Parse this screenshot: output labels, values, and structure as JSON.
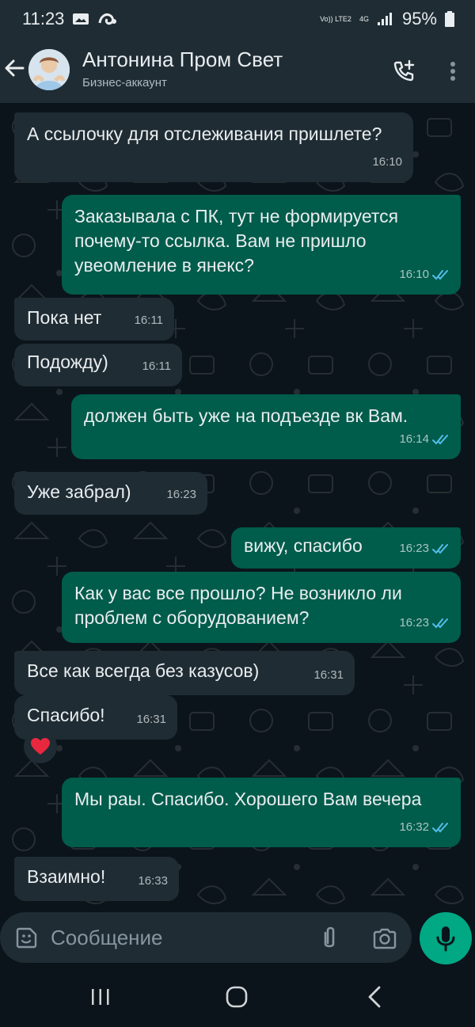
{
  "status_bar": {
    "time": "11:23",
    "network_label": "Vo)) LTE2",
    "network_type": "4G",
    "battery": "95%"
  },
  "header": {
    "contact_name": "Антонина Пром Свет",
    "contact_status": "Бизнес-аккаунт",
    "icons": [
      "back-arrow-icon",
      "avatar",
      "add-call-icon",
      "more-vert-icon"
    ]
  },
  "messages": [
    {
      "text": "А ссылочку для отслеживания пришлете?",
      "time": "16:10",
      "direction": "in"
    },
    {
      "text": "Заказывала с ПК, тут не формируется почему-то ссылка. Вам не пришло увеомление в янекс?",
      "time": "16:10",
      "direction": "out",
      "read": true
    },
    {
      "text": "Пока нет",
      "time": "16:11",
      "direction": "in"
    },
    {
      "text": "Подожду)",
      "time": "16:11",
      "direction": "in"
    },
    {
      "text": "должен быть уже на подъезде вк Вам.",
      "time": "16:14",
      "direction": "out",
      "read": true
    },
    {
      "text": "Уже забрал)",
      "time": "16:23",
      "direction": "in"
    },
    {
      "text": "вижу, спасибо",
      "time": "16:23",
      "direction": "out",
      "read": true
    },
    {
      "text": "Как у вас все прошло? Не возникло ли проблем с оборудованием?",
      "time": "16:23",
      "direction": "out",
      "read": true
    },
    {
      "text": "Все как всегда без казусов)",
      "time": "16:31",
      "direction": "in"
    },
    {
      "text": "Спасибо!",
      "time": "16:31",
      "direction": "in",
      "reaction": "heart"
    },
    {
      "text": "Мы раы. Спасибо. Хорошего Вам вечера",
      "time": "16:32",
      "direction": "out",
      "read": true
    },
    {
      "text": "Взаимно!",
      "time": "16:33",
      "direction": "in"
    }
  ],
  "composer": {
    "placeholder": "Сообщение",
    "icons": [
      "emoji-icon",
      "attach-icon",
      "camera-icon",
      "mic-icon"
    ]
  },
  "colors": {
    "background": "#0b141a",
    "bar": "#1f2c34",
    "incoming": "#1f2c34",
    "outgoing": "#005c4b",
    "accent": "#00a884",
    "read_ticks": "#53bdeb"
  }
}
